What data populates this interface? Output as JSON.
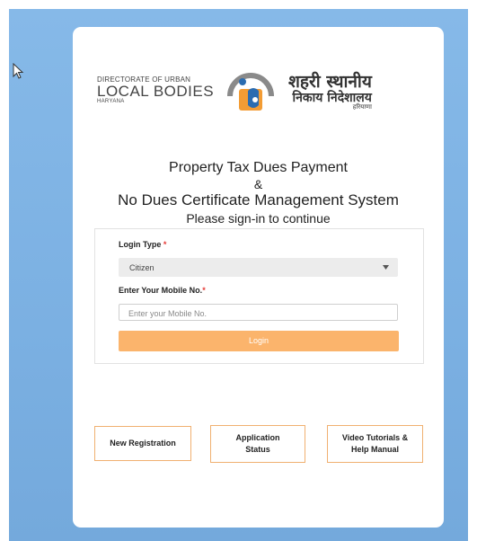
{
  "header": {
    "logo_en_line1": "DIRECTORATE OF URBAN",
    "logo_en_line2": "LOCAL BODIES",
    "logo_en_line3": "HARYANA",
    "logo_hi_line1": "शहरी स्थानीय",
    "logo_hi_line2": "निकाय निदेशालय",
    "logo_hi_line3": "हरियाणा"
  },
  "title": {
    "line1": "Property Tax Dues Payment",
    "line2": "&",
    "line3": "No Dues Certificate Management System",
    "subtitle": "Please sign-in to continue"
  },
  "form": {
    "login_type_label": "Login Type",
    "required_mark": "*",
    "login_type_value": "Citizen",
    "mobile_label": "Enter Your Mobile No.",
    "mobile_placeholder": "Enter your Mobile No.",
    "login_button": "Login"
  },
  "tiles": {
    "new_registration": "New Registration",
    "application_status_1": "Application",
    "application_status_2": "Status",
    "video_tutorials_1": "Video Tutorials &",
    "video_tutorials_2": "Help Manual"
  },
  "colors": {
    "background": "#7bb0e2",
    "accent": "#fbb46c",
    "required": "#e53935"
  }
}
